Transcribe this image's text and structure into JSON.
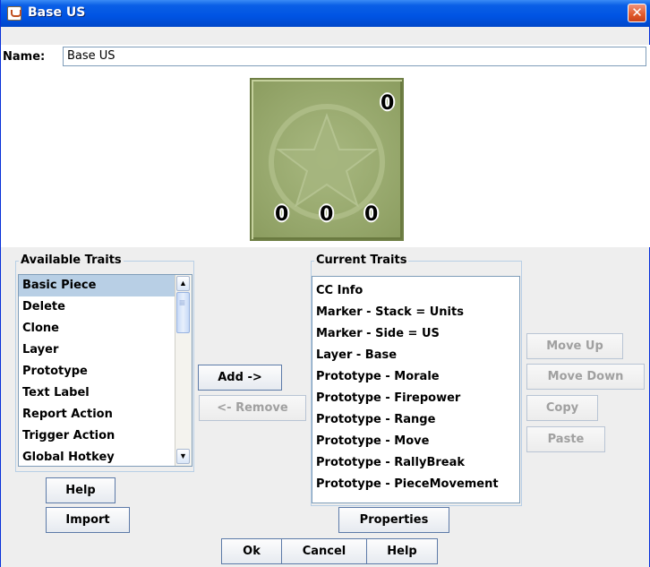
{
  "window": {
    "title": "Base US",
    "close_glyph": "✕"
  },
  "name_field": {
    "label": "Name:",
    "value": "Base US"
  },
  "piece_preview": {
    "top_right_value": "0",
    "bottom_values": [
      "0",
      "0",
      "0"
    ],
    "color": "#97a86d"
  },
  "available_traits": {
    "title": "Available Traits",
    "items": [
      "Basic Piece",
      "Delete",
      "Clone",
      "Layer",
      "Prototype",
      "Text Label",
      "Report Action",
      "Trigger Action",
      "Global Hotkey"
    ],
    "selected": "Basic Piece"
  },
  "current_traits": {
    "title": "Current Traits",
    "items": [
      "CC Info",
      "Marker - Stack = Units",
      "Marker - Side = US",
      "Layer - Base",
      "Prototype - Morale",
      "Prototype - Firepower",
      "Prototype - Range",
      "Prototype - Move",
      "Prototype - RallyBreak",
      "Prototype - PieceMovement"
    ]
  },
  "buttons": {
    "add": "Add ->",
    "remove": "<- Remove",
    "help_left": "Help",
    "import": "Import",
    "properties": "Properties",
    "move_up": "Move Up",
    "move_down": "Move Down",
    "copy": "Copy",
    "paste": "Paste",
    "ok": "Ok",
    "cancel": "Cancel",
    "help_bottom": "Help"
  },
  "scrollbar": {
    "up_glyph": "▲",
    "down_glyph": "▼"
  },
  "colors": {
    "selection": "#b8cfe5",
    "titlebar": "#0054e3",
    "accent_border": "#7f9db9"
  }
}
